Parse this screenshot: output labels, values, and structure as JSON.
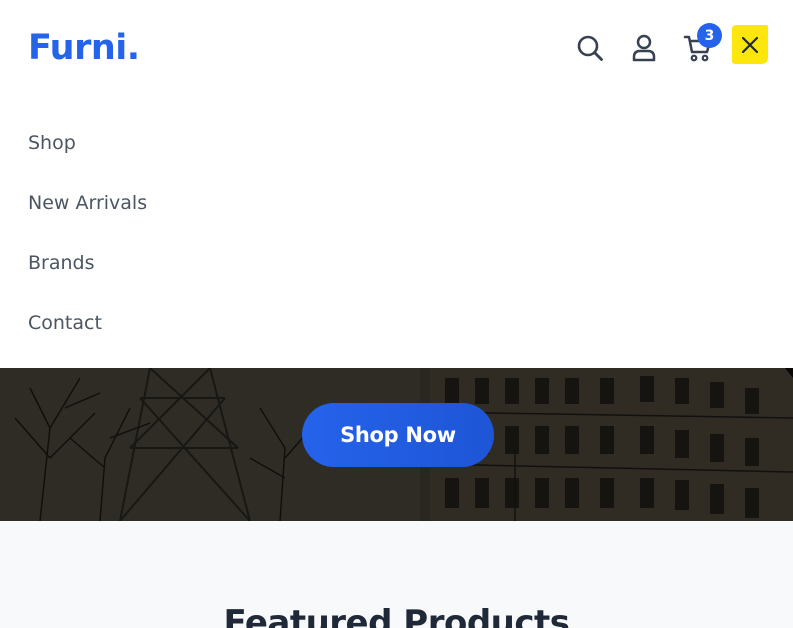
{
  "brand": {
    "logo": "Furni."
  },
  "header": {
    "icons": [
      "search-icon",
      "user-icon",
      "cart-icon",
      "close-icon"
    ],
    "cart_count": "3"
  },
  "menu": {
    "items": [
      {
        "label": "Shop"
      },
      {
        "label": "New Arrivals"
      },
      {
        "label": "Brands"
      },
      {
        "label": "Contact"
      }
    ]
  },
  "hero": {
    "cta_label": "Shop Now"
  },
  "featured": {
    "title": "Featured Products"
  },
  "colors": {
    "accent": "#2563eb",
    "highlight": "#fde60b",
    "menu_text": "#4b5563",
    "section_bg": "#f8f9fb"
  }
}
